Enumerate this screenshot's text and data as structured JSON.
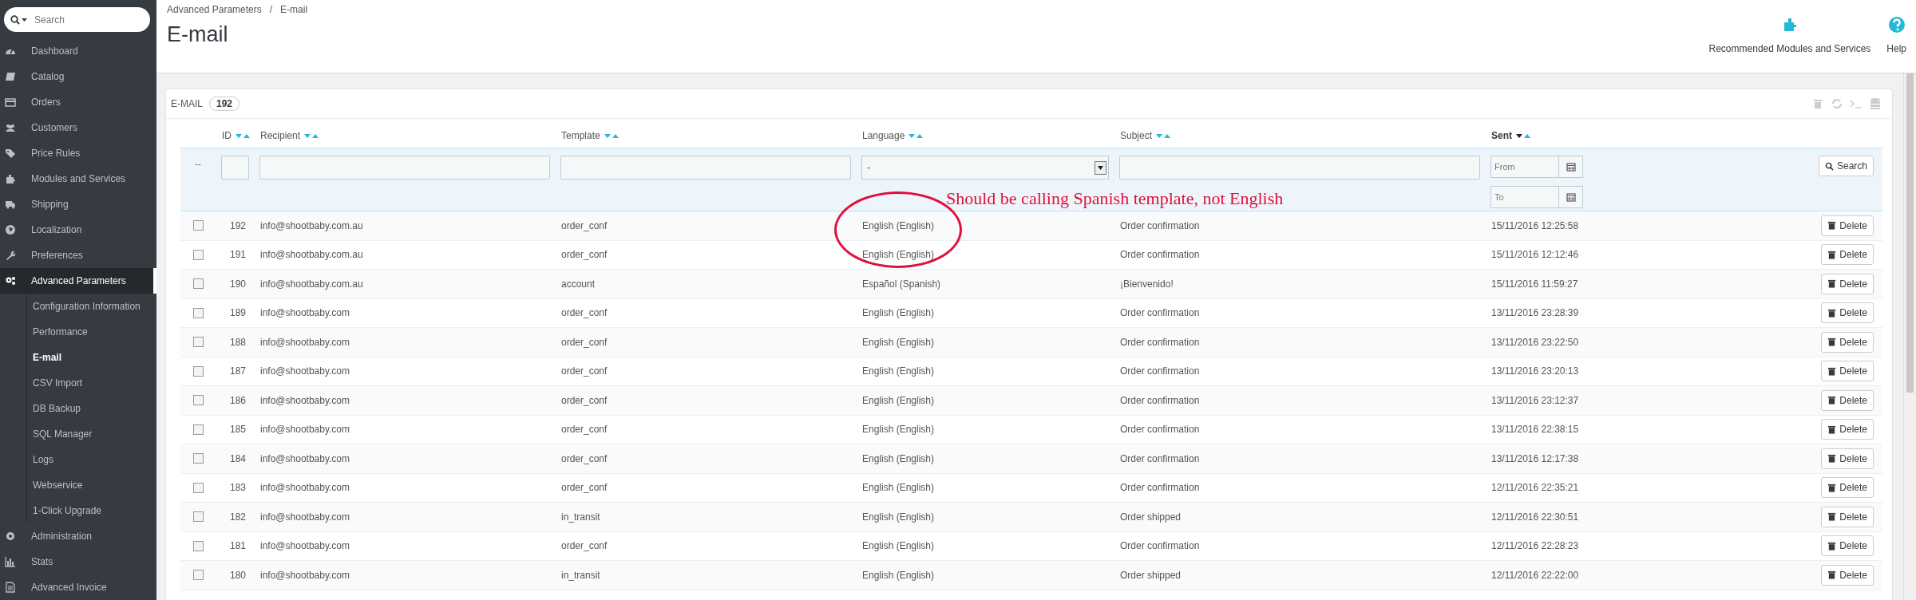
{
  "sidebar": {
    "search": {
      "placeholder": "Search"
    },
    "items": [
      {
        "label": "Dashboard",
        "selected": false
      },
      {
        "label": "Catalog",
        "selected": false
      },
      {
        "label": "Orders",
        "selected": false
      },
      {
        "label": "Customers",
        "selected": false
      },
      {
        "label": "Price Rules",
        "selected": false
      },
      {
        "label": "Modules and Services",
        "selected": false
      },
      {
        "label": "Shipping",
        "selected": false
      },
      {
        "label": "Localization",
        "selected": false
      },
      {
        "label": "Preferences",
        "selected": false
      },
      {
        "label": "Advanced Parameters",
        "selected": true,
        "children": [
          {
            "label": "Configuration Information",
            "selected": false
          },
          {
            "label": "Performance",
            "selected": false
          },
          {
            "label": "E-mail",
            "selected": true
          },
          {
            "label": "CSV Import",
            "selected": false
          },
          {
            "label": "DB Backup",
            "selected": false
          },
          {
            "label": "SQL Manager",
            "selected": false
          },
          {
            "label": "Logs",
            "selected": false
          },
          {
            "label": "Webservice",
            "selected": false
          },
          {
            "label": "1-Click Upgrade",
            "selected": false
          }
        ]
      },
      {
        "label": "Administration",
        "selected": false
      },
      {
        "label": "Stats",
        "selected": false
      },
      {
        "label": "Advanced Invoice",
        "selected": false
      }
    ]
  },
  "breadcrumb": [
    "Advanced Parameters",
    "E-mail"
  ],
  "breadcrumb_separator": "/",
  "page_title": "E-mail",
  "toolbar": [
    {
      "label": "Recommended Modules and Services"
    },
    {
      "label": "Help"
    }
  ],
  "panel": {
    "title": "E-MAIL",
    "count": "192"
  },
  "table": {
    "columns": [
      {
        "label": "ID",
        "sorted": false
      },
      {
        "label": "Recipient",
        "sorted": false
      },
      {
        "label": "Template",
        "sorted": false
      },
      {
        "label": "Language",
        "sorted": false
      },
      {
        "label": "Subject",
        "sorted": false
      },
      {
        "label": "Sent",
        "sorted": true
      }
    ],
    "filters": {
      "reset": "--",
      "language": "-",
      "from_placeholder": "From",
      "to_placeholder": "To",
      "search_button": "Search"
    },
    "rows": [
      {
        "checked": false,
        "cells": [
          "192",
          "info@shootbaby.com.au",
          "order_conf",
          "English (English)",
          "Order confirmation",
          "15/11/2016 12:25:58"
        ],
        "action": "Delete"
      },
      {
        "checked": false,
        "cells": [
          "191",
          "info@shootbaby.com.au",
          "order_conf",
          "English (English)",
          "Order confirmation",
          "15/11/2016 12:12:46"
        ],
        "action": "Delete"
      },
      {
        "checked": false,
        "cells": [
          "190",
          "info@shootbaby.com.au",
          "account",
          "Español (Spanish)",
          "¡Bienvenido!",
          "15/11/2016 11:59:27"
        ],
        "action": "Delete"
      },
      {
        "checked": false,
        "cells": [
          "189",
          "info@shootbaby.com",
          "order_conf",
          "English (English)",
          "Order confirmation",
          "13/11/2016 23:28:39"
        ],
        "action": "Delete"
      },
      {
        "checked": false,
        "cells": [
          "188",
          "info@shootbaby.com",
          "order_conf",
          "English (English)",
          "Order confirmation",
          "13/11/2016 23:22:50"
        ],
        "action": "Delete"
      },
      {
        "checked": false,
        "cells": [
          "187",
          "info@shootbaby.com",
          "order_conf",
          "English (English)",
          "Order confirmation",
          "13/11/2016 23:20:13"
        ],
        "action": "Delete"
      },
      {
        "checked": false,
        "cells": [
          "186",
          "info@shootbaby.com",
          "order_conf",
          "English (English)",
          "Order confirmation",
          "13/11/2016 23:12:37"
        ],
        "action": "Delete"
      },
      {
        "checked": false,
        "cells": [
          "185",
          "info@shootbaby.com",
          "order_conf",
          "English (English)",
          "Order confirmation",
          "13/11/2016 22:38:15"
        ],
        "action": "Delete"
      },
      {
        "checked": false,
        "cells": [
          "184",
          "info@shootbaby.com",
          "order_conf",
          "English (English)",
          "Order confirmation",
          "13/11/2016 12:17:38"
        ],
        "action": "Delete"
      },
      {
        "checked": false,
        "cells": [
          "183",
          "info@shootbaby.com",
          "order_conf",
          "English (English)",
          "Order confirmation",
          "12/11/2016 22:35:21"
        ],
        "action": "Delete"
      },
      {
        "checked": false,
        "cells": [
          "182",
          "info@shootbaby.com",
          "in_transit",
          "English (English)",
          "Order shipped",
          "12/11/2016 22:30:51"
        ],
        "action": "Delete"
      },
      {
        "checked": false,
        "cells": [
          "181",
          "info@shootbaby.com",
          "order_conf",
          "English (English)",
          "Order confirmation",
          "12/11/2016 22:28:23"
        ],
        "action": "Delete"
      },
      {
        "checked": false,
        "cells": [
          "180",
          "info@shootbaby.com",
          "in_transit",
          "English (English)",
          "Order shipped",
          "12/11/2016 22:22:00"
        ],
        "action": "Delete"
      }
    ]
  },
  "annotation": {
    "text": "Should be calling Spanish template, not English"
  }
}
